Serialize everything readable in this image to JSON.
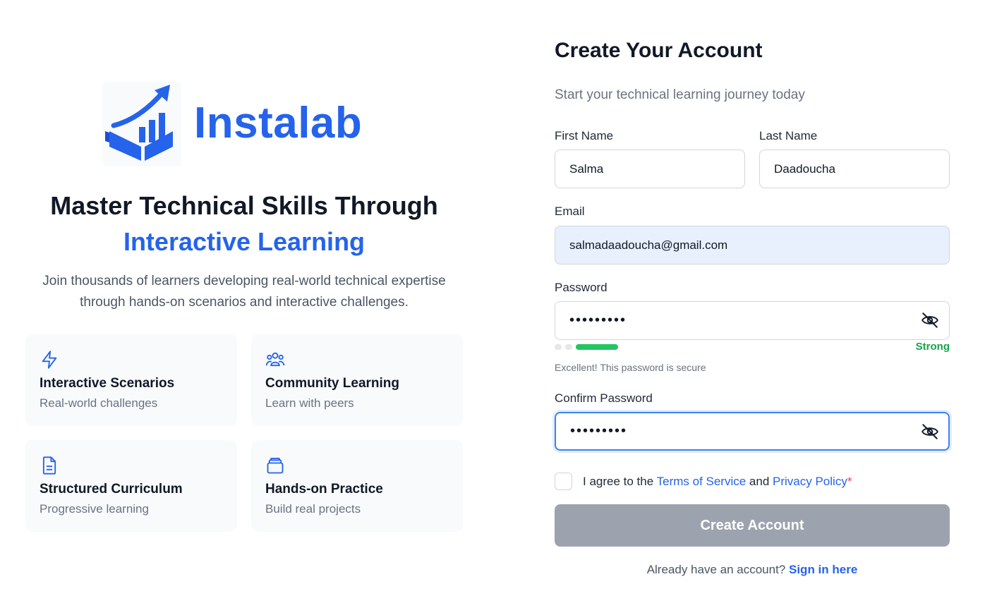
{
  "brand": {
    "logo_text": "Instalab",
    "logo_icon": "book-growth-chart-icon",
    "accent": "#2563eb"
  },
  "hero": {
    "headline_line1": "Master Technical Skills Through",
    "headline_line2": "Interactive Learning",
    "intro": "Join thousands of learners developing real-world technical expertise through hands-on scenarios and interactive challenges."
  },
  "features": [
    {
      "icon": "lightning-icon",
      "title": "Interactive Scenarios",
      "description": "Real-world challenges"
    },
    {
      "icon": "users-group-icon",
      "title": "Community Learning",
      "description": "Learn with peers"
    },
    {
      "icon": "document-icon",
      "title": "Structured Curriculum",
      "description": "Progressive learning"
    },
    {
      "icon": "layers-icon",
      "title": "Hands-on Practice",
      "description": "Build real projects"
    }
  ],
  "form": {
    "title": "Create Your Account",
    "subtitle": "Start your technical learning journey today",
    "first_name": {
      "label": "First Name",
      "value": "Salma"
    },
    "last_name": {
      "label": "Last Name",
      "value": "Daadoucha"
    },
    "email": {
      "label": "Email",
      "value": "salmadaadoucha@gmail.com"
    },
    "password": {
      "label": "Password",
      "value": "•••••••••",
      "strength_label": "Strong",
      "strength_level": 3,
      "strength_max": 3,
      "hint": "Excellent! This password is secure"
    },
    "confirm_password": {
      "label": "Confirm Password",
      "value": "•••••••••"
    },
    "agree": {
      "checked": false,
      "prefix": "I agree to the ",
      "terms": "Terms of Service",
      "middle": " and ",
      "privacy": "Privacy Policy",
      "required_mark": "*"
    },
    "submit_label": "Create Account",
    "signin_prompt": "Already have an account? ",
    "signin_link": "Sign in here"
  }
}
